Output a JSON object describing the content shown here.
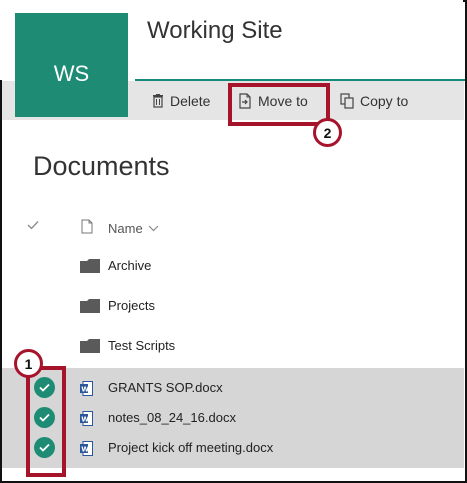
{
  "header": {
    "logo_text": "WS",
    "site_title": "Working Site"
  },
  "command_bar": {
    "delete_label": "Delete",
    "move_label": "Move to",
    "copy_label": "Copy to"
  },
  "callouts": {
    "first": "1",
    "second": "2"
  },
  "documents": {
    "title": "Documents",
    "name_column": "Name",
    "folders": [
      {
        "name": "Archive"
      },
      {
        "name": "Projects"
      },
      {
        "name": "Test Scripts"
      }
    ],
    "files": [
      {
        "name": "GRANTS SOP.docx",
        "selected": true
      },
      {
        "name": "notes_08_24_16.docx",
        "selected": true
      },
      {
        "name": "Project kick off meeting.docx",
        "selected": true
      }
    ]
  },
  "colors": {
    "accent": "#1e8c74",
    "highlight": "#a6142c",
    "command_bar": "#e5e5e5",
    "selected_row": "#d6d6d6",
    "word_icon": "#2b579a"
  }
}
